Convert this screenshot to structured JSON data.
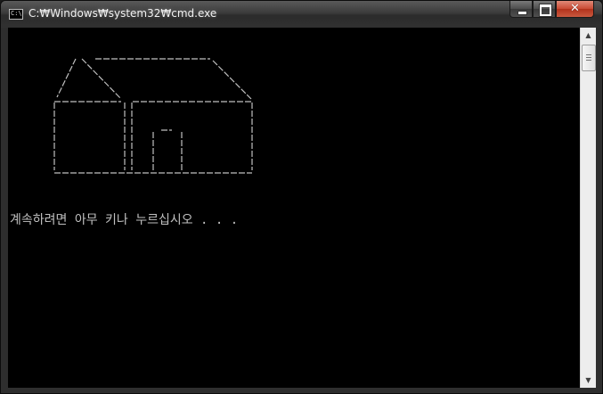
{
  "window": {
    "title": "C:₩Windows₩system32₩cmd.exe",
    "app_icon_glyph": "C:\\",
    "caption_buttons": {
      "minimize_icon": "minimize-icon",
      "maximize_icon": "maximize-icon",
      "close_glyph": "✕"
    }
  },
  "console": {
    "background_color": "#000000",
    "text_color": "#c0c0c0",
    "ascii_art": "house-drawing",
    "prompt": "계속하려면 아무 키나 누르십시오 . . ."
  },
  "scrollbar": {
    "up_arrow": "▲",
    "down_arrow": "▼"
  }
}
